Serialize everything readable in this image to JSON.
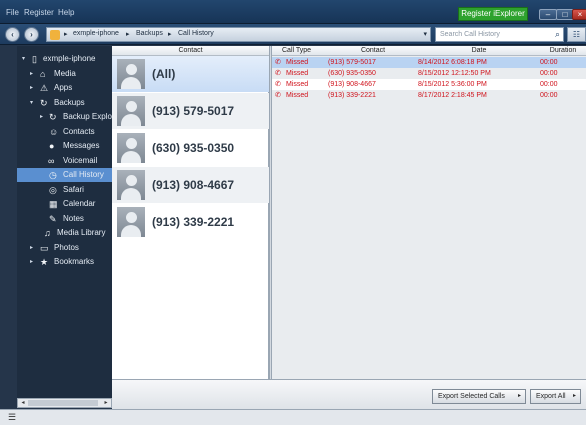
{
  "menubar": {
    "items": [
      "File",
      "Register",
      "Help"
    ],
    "register_button": "Register iExplorer",
    "window_controls": {
      "minimize": "minimize-icon",
      "maximize": "maximize-icon",
      "close": "close-icon"
    }
  },
  "nav": {
    "back": "back-icon",
    "forward": "forward-icon",
    "breadcrumb": [
      "exmple-iphone",
      "Backups",
      "Call History"
    ],
    "search_placeholder": "Search Call History"
  },
  "sidebar": {
    "items": [
      {
        "label": "exmple-iphone",
        "icon": "phone-icon",
        "expanded": true
      },
      {
        "label": "Media",
        "icon": "media-icon"
      },
      {
        "label": "Apps",
        "icon": "apps-icon"
      },
      {
        "label": "Backups",
        "icon": "backup-icon",
        "expanded": true
      },
      {
        "label": "Backup Explorer",
        "icon": "backup-icon"
      },
      {
        "label": "Contacts",
        "icon": "contacts-icon"
      },
      {
        "label": "Messages",
        "icon": "message-icon"
      },
      {
        "label": "Voicemail",
        "icon": "voicemail-icon"
      },
      {
        "label": "Call History",
        "icon": "clock-icon",
        "selected": true
      },
      {
        "label": "Safari",
        "icon": "compass-icon"
      },
      {
        "label": "Calendar",
        "icon": "calendar-icon"
      },
      {
        "label": "Notes",
        "icon": "notes-icon"
      },
      {
        "label": "Media Library",
        "icon": "music-icon"
      },
      {
        "label": "Photos",
        "icon": "photo-icon"
      },
      {
        "label": "Bookmarks",
        "icon": "star-icon"
      }
    ]
  },
  "contacts": {
    "header": "Contact",
    "rows": [
      "(All)",
      "(913) 579-5017",
      "(630) 935-0350",
      "(913) 908-4667",
      "(913) 339-2221"
    ]
  },
  "calls": {
    "headers": {
      "type": "Call Type",
      "contact": "Contact",
      "date": "Date",
      "duration": "Duration"
    },
    "rows": [
      {
        "type": "Missed",
        "contact": "(913) 579-5017",
        "date": "8/14/2012 6:08:18 PM",
        "duration": "00:00"
      },
      {
        "type": "Missed",
        "contact": "(630) 935-0350",
        "date": "8/15/2012 12:12:50 PM",
        "duration": "00:00"
      },
      {
        "type": "Missed",
        "contact": "(913) 908-4667",
        "date": "8/15/2012 5:36:00 PM",
        "duration": "00:00"
      },
      {
        "type": "Missed",
        "contact": "(913) 339-2221",
        "date": "8/17/2012 2:18:45 PM",
        "duration": "00:00"
      }
    ]
  },
  "bottom": {
    "export_selected": "Export Selected Calls",
    "export_all": "Export All"
  },
  "colors": {
    "accent": "#5a8fd0",
    "missed": "#d0121b",
    "register": "#2ea22e"
  }
}
